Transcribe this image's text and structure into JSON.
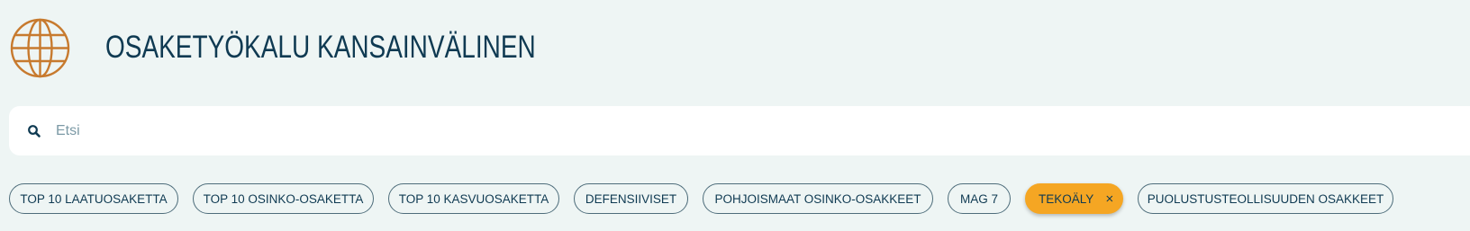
{
  "header": {
    "title": "OSAKETYÖKALU KANSAINVÄLINEN",
    "logo_icon": "globe-icon"
  },
  "search": {
    "placeholder": "Etsi",
    "value": "",
    "icon": "search-icon"
  },
  "chips": [
    {
      "label": "TOP 10 LAATUOSAKETTA",
      "active": false
    },
    {
      "label": "TOP 10 OSINKO-OSAKETTA",
      "active": false
    },
    {
      "label": "TOP 10 KASVUOSAKETTA",
      "active": false
    },
    {
      "label": "DEFENSIIVISET",
      "active": false
    },
    {
      "label": "POHJOISMAAT OSINKO-OSAKKEET",
      "active": false
    },
    {
      "label": "MAG 7",
      "active": false
    },
    {
      "label": "TEKOÄLY",
      "active": true,
      "close_icon": "close-icon"
    },
    {
      "label": "PUOLUSTUSTEOLLISUUDEN OSAKKEET",
      "active": false
    }
  ],
  "colors": {
    "background": "#eef5f4",
    "title": "#0f3a52",
    "logo": "#c77a2e",
    "active_chip": "#f5a623",
    "chip_border": "#4e6d7b"
  }
}
